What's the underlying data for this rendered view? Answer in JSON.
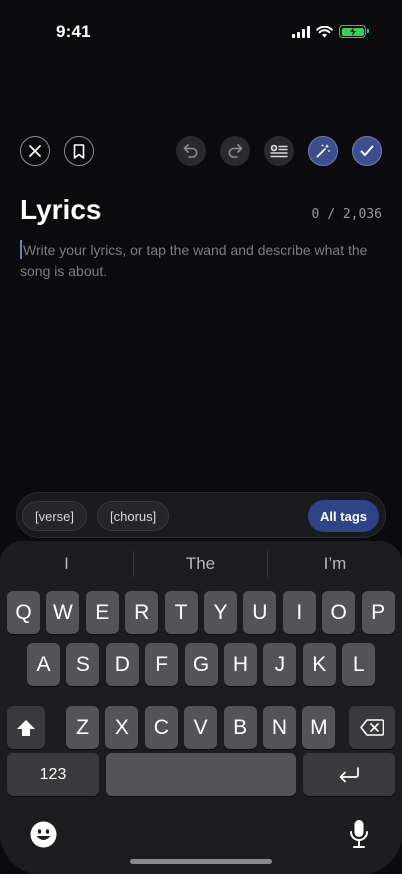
{
  "status_bar": {
    "time": "9:41",
    "battery_color": "#3ad15a"
  },
  "toolbar": {
    "close_icon": "close-icon",
    "bookmark_icon": "bookmark-icon",
    "undo_icon": "undo-icon",
    "redo_icon": "redo-icon",
    "format_icon": "add-section-icon",
    "wand_icon": "magic-wand-icon",
    "confirm_icon": "checkmark-icon",
    "accent_color": "#3c4f8c"
  },
  "editor": {
    "title": "Lyrics",
    "counter": "0 / 2,036",
    "placeholder": "Write your lyrics, or tap the wand and describe what the song is about."
  },
  "tags": {
    "chips": [
      "[verse]",
      "[chorus]"
    ],
    "all_tags_label": "All tags"
  },
  "keyboard": {
    "suggestions": [
      "I",
      "The",
      "I’m"
    ],
    "row1": [
      "Q",
      "W",
      "E",
      "R",
      "T",
      "Y",
      "U",
      "I",
      "O",
      "P"
    ],
    "row2": [
      "A",
      "S",
      "D",
      "F",
      "G",
      "H",
      "J",
      "K",
      "L"
    ],
    "row3": [
      "Z",
      "X",
      "C",
      "V",
      "B",
      "N",
      "M"
    ],
    "numbers_label": "123",
    "shift_icon": "shift-icon",
    "backspace_icon": "backspace-icon",
    "return_icon": "return-icon",
    "emoji_icon": "emoji-icon",
    "mic_icon": "microphone-icon"
  }
}
